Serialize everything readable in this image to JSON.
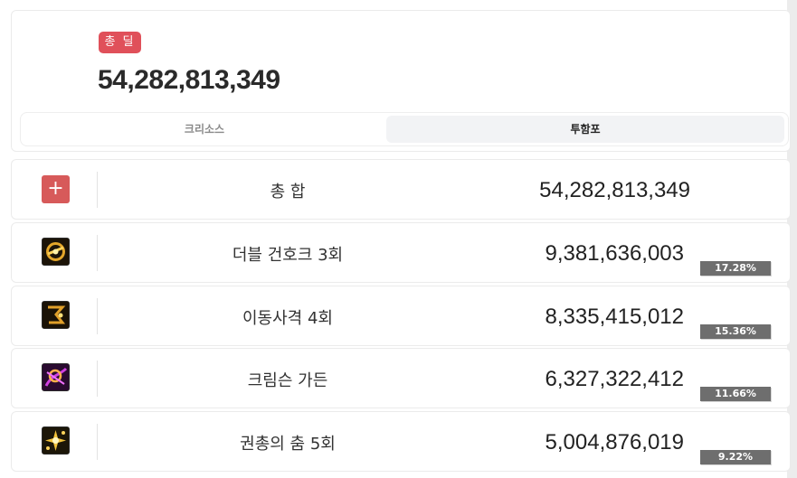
{
  "summary": {
    "badge": "총 딜",
    "total": "54,282,813,349",
    "tabs": [
      "크리소스",
      "투함포"
    ],
    "active_tab": "투함포"
  },
  "total_row": {
    "icon": "plus-icon",
    "label": "총 합",
    "value": "54,282,813,349"
  },
  "skills": [
    {
      "name": "더블 건호크 3회",
      "value": "9,381,636,003",
      "percent": "17.28%",
      "icon": "double-gunhawk-skill-icon"
    },
    {
      "name": "이동사격 4회",
      "value": "8,335,415,012",
      "percent": "15.36%",
      "icon": "moving-shot-skill-icon"
    },
    {
      "name": "크림슨 가든",
      "value": "6,327,322,412",
      "percent": "11.66%",
      "icon": "crimson-garden-skill-icon"
    },
    {
      "name": "권총의 춤 5회",
      "value": "5,004,876,019",
      "percent": "9.22%",
      "icon": "pistol-dance-skill-icon"
    }
  ],
  "colors": {
    "badge": "#e0505a",
    "plus_icon": "#d75a5a",
    "percent_badge": "#6e6e6e"
  }
}
